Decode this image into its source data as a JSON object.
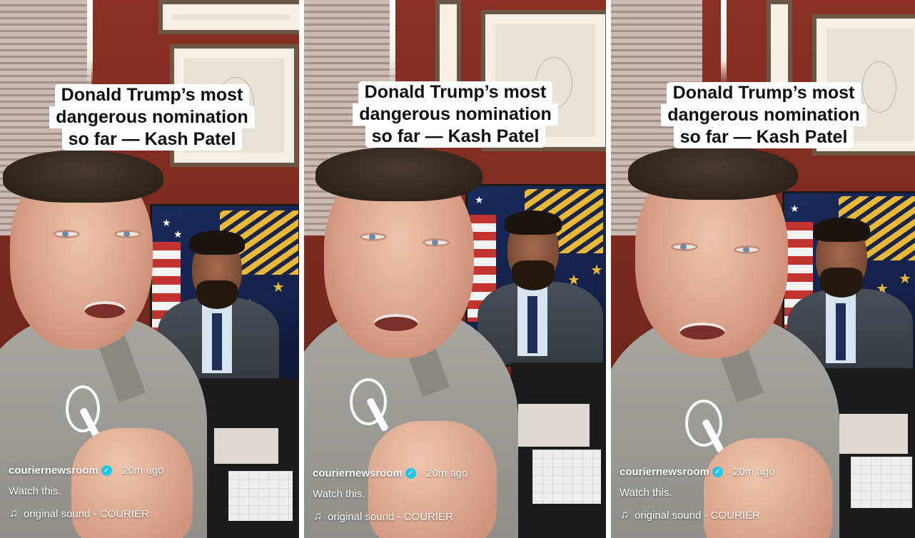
{
  "panels": [
    {
      "caption_lines": [
        "Donald Trump’s most",
        "dangerous nomination",
        "so far — Kash Patel"
      ],
      "author": "couriernewsroom",
      "verified_icon": "verified-check-icon",
      "time": "· 20m ago",
      "description": "Watch this.",
      "sound_icon": "music-note-icon",
      "sound": "original sound - COURIER"
    },
    {
      "caption_lines": [
        "Donald Trump’s most",
        "dangerous nomination",
        "so far — Kash Patel"
      ],
      "author": "couriernewsroom",
      "verified_icon": "verified-check-icon",
      "time": "· 20m ago",
      "description": "Watch this.",
      "sound_icon": "music-note-icon",
      "sound": "original sound - COURIER"
    },
    {
      "caption_lines": [
        "Donald Trump’s most",
        "dangerous nomination",
        "so far — Kash Patel"
      ],
      "author": "couriernewsroom",
      "verified_icon": "verified-check-icon",
      "time": "· 20m ago",
      "description": "Watch this.",
      "sound_icon": "music-note-icon",
      "sound": "original sound - COURIER"
    }
  ],
  "colors": {
    "caption_bg": "#ffffff",
    "caption_text": "#111111",
    "verified": "#20c5e8",
    "overlay_text": "#ffffff",
    "wall": "#7d2a20"
  }
}
